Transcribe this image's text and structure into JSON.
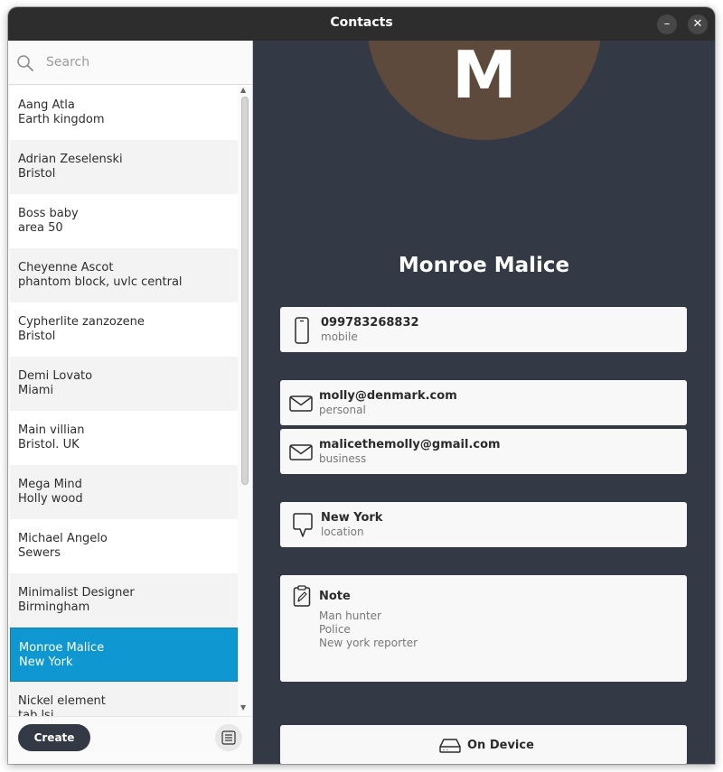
{
  "window": {
    "title": "Contacts",
    "minimize_glyph": "–",
    "close_glyph": "✕"
  },
  "search": {
    "placeholder": "Search",
    "icon": "search-icon"
  },
  "contacts": [
    {
      "name": "Aang Atla",
      "place": "Earth kingdom"
    },
    {
      "name": "Adrian Zeselenski",
      "place": "Bristol"
    },
    {
      "name": "Boss baby",
      "place": "area 50"
    },
    {
      "name": "Cheyenne Ascot",
      "place": "phantom block, uvlc central"
    },
    {
      "name": "Cypherlite zanzozene",
      "place": "Bristol"
    },
    {
      "name": "Demi Lovato",
      "place": "Miami"
    },
    {
      "name": "Main villian",
      "place": "Bristol. UK"
    },
    {
      "name": "Mega Mind",
      "place": "Holly wood"
    },
    {
      "name": "Michael Angelo",
      "place": "Sewers"
    },
    {
      "name": "Minimalist Designer",
      "place": "Birmingham"
    },
    {
      "name": "Monroe Malice",
      "place": "New York"
    },
    {
      "name": "Nickel element",
      "place": "tab lsi"
    }
  ],
  "selected_index": 10,
  "footer": {
    "create_label": "Create",
    "menu_icon": "list-menu-icon"
  },
  "detail": {
    "avatar_letter": "M",
    "name": "Monroe Malice",
    "phone": {
      "value": "099783268832",
      "type": "mobile",
      "icon": "phone-icon"
    },
    "emails": [
      {
        "value": "molly@denmark.com",
        "type": "personal",
        "icon": "mail-icon"
      },
      {
        "value": "malicethemolly@gmail.com",
        "type": "business",
        "icon": "mail-icon"
      }
    ],
    "address": {
      "value": "New York",
      "type": "location",
      "icon": "location-icon"
    },
    "note": {
      "title": "Note",
      "icon": "note-icon",
      "lines": [
        "Man hunter",
        "Police",
        "New york reporter"
      ]
    },
    "storage": {
      "label": "On Device",
      "icon": "drive-icon"
    }
  },
  "colors": {
    "titlebar": "#2d2d2d",
    "detail_bg": "#343a45",
    "avatar_bg": "#5e4a3c",
    "selection": "#0e97d0",
    "create_button": "#343a45"
  }
}
